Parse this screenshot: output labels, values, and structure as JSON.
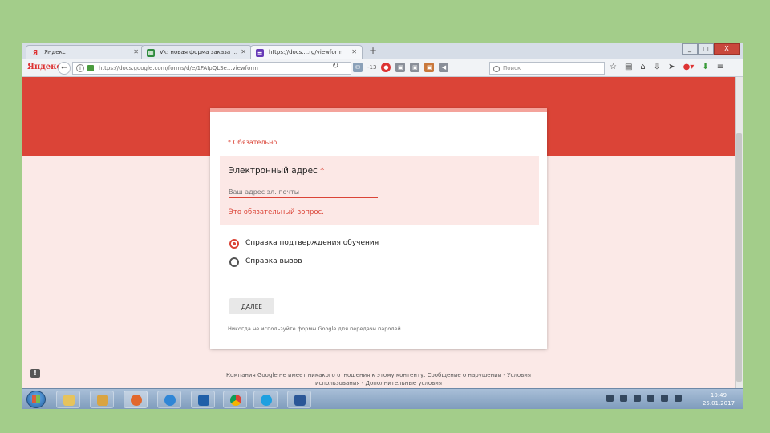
{
  "browser": {
    "tabs": [
      {
        "label": "Яндекс",
        "icon": "yandex-icon"
      },
      {
        "label": "Vk: новая форма заказа ...",
        "icon": "sheets-icon"
      },
      {
        "label": "https://docs....rg/viewform",
        "icon": "forms-icon"
      }
    ],
    "new_tab_label": "+",
    "window_buttons": {
      "minimize": "_",
      "maximize": "□",
      "close": "X"
    },
    "logo": "Яндекс",
    "url": "https://docs.google.com/forms/d/e/1FAIpQLSe...viewform",
    "search_placeholder": "Поиск",
    "weather": "-13"
  },
  "form": {
    "required_note": "* Обязательно",
    "question": {
      "title": "Электронный адрес",
      "required_mark": "*",
      "placeholder": "Ваш адрес эл. почты",
      "error": "Это обязательный вопрос."
    },
    "options": [
      {
        "label": "Справка подтверждения обучения",
        "selected": true
      },
      {
        "label": "Справка вызов",
        "selected": false
      }
    ],
    "next_button": "ДАЛЕЕ",
    "password_warning": "Никогда не используйте формы Google для передачи паролей.",
    "footer_line1": "Компания Google не имеет никакого отношения к этому контенту. Сообщение о нарушении - Условия",
    "footer_line2": "использования - Дополнительные условия",
    "feedback_icon": "!"
  },
  "taskbar": {
    "time": "10:49",
    "date": "25.01.2017",
    "apps": [
      "explorer-icon",
      "media-player-icon",
      "firefox-icon",
      "ie-icon",
      "outlook-icon",
      "chrome-icon",
      "skype-icon",
      "word-icon"
    ]
  },
  "colors": {
    "accent": "#db4437",
    "background": "#a3cd8a",
    "page": "#fbe9e7"
  }
}
